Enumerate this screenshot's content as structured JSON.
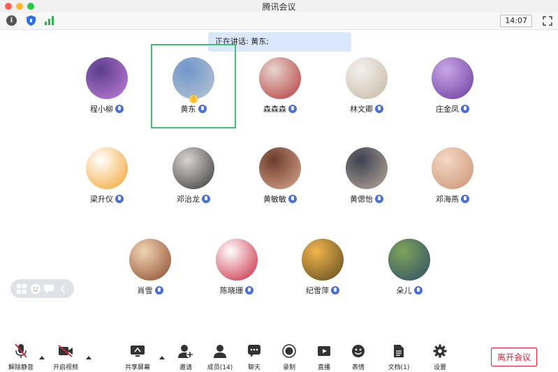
{
  "window": {
    "title": "腾讯会议"
  },
  "status": {
    "time": "14:07"
  },
  "speaking_banner": "正在讲话: 黄东;",
  "participants": [
    {
      "name": "程小柳",
      "avatar": [
        "#5a3e8c",
        "#c17fd9"
      ]
    },
    {
      "name": "黄东",
      "avatar": [
        "#6f95c8",
        "#b9c7d4"
      ]
    },
    {
      "name": "森森森",
      "avatar": [
        "#e7d5cf",
        "#b53a3a"
      ]
    },
    {
      "name": "林文卿",
      "avatar": [
        "#f3f1ed",
        "#c5b7a2"
      ]
    },
    {
      "name": "庄金凤",
      "avatar": [
        "#c8a8e8",
        "#6a3a9c"
      ]
    },
    {
      "name": "梁升仪",
      "avatar": [
        "#ffffff",
        "#f2a12c"
      ]
    },
    {
      "name": "邓治龙",
      "avatar": [
        "#d8d3cf",
        "#3a3a3a"
      ]
    },
    {
      "name": "黄敏敏",
      "avatar": [
        "#6e3c2c",
        "#d9a88e"
      ]
    },
    {
      "name": "黄偲怡",
      "avatar": [
        "#3d4150",
        "#b9a99a"
      ]
    },
    {
      "name": "邓海燕",
      "avatar": [
        "#f4d9c6",
        "#c99272"
      ]
    },
    {
      "name": "肖雪",
      "avatar": [
        "#f1d4b3",
        "#8a4a2c"
      ]
    },
    {
      "name": "陈晓珊",
      "avatar": [
        "#ffffff",
        "#c8243c"
      ]
    },
    {
      "name": "纪雪萍",
      "avatar": [
        "#f1b54d",
        "#5c4a1c"
      ]
    },
    {
      "name": "朵儿",
      "avatar": [
        "#7ea45a",
        "#2f4c68"
      ]
    }
  ],
  "toolbar": {
    "unmute": "解除静音",
    "start_video": "开启视频",
    "share_screen": "共享屏幕",
    "invite": "邀请",
    "members": "成员(14)",
    "chat": "聊天",
    "record": "录制",
    "live": "直播",
    "reactions": "表情",
    "docs": "文档(1)",
    "settings": "设置",
    "leave": "离开会议"
  },
  "icons": [
    "info-icon",
    "shield-icon",
    "signal-icon",
    "fullscreen-icon",
    "mic-icon",
    "grid-icon",
    "emoji-icon",
    "chat-icon",
    "chevron-left-icon",
    "mic-off-icon",
    "video-off-icon",
    "share-screen-icon",
    "invite-icon",
    "members-icon",
    "chat-icon",
    "record-icon",
    "live-icon",
    "emoji-icon",
    "document-icon",
    "gear-icon"
  ],
  "colors": {
    "accent": "#4a6fd6",
    "speaking_border": "#3fbf75",
    "leave": "#d7263d",
    "banner": "#dbe8fb"
  }
}
